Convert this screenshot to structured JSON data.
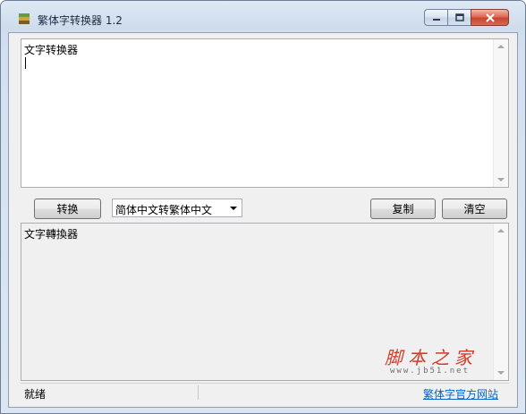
{
  "window": {
    "title": "繁体字转换器 1.2",
    "icon": "app-icon"
  },
  "caption_buttons": {
    "minimize_icon": "minimize-icon",
    "maximize_icon": "maximize-icon",
    "close_icon": "close-icon"
  },
  "input": {
    "text": "文字转换器"
  },
  "toolbar": {
    "convert_label": "转换",
    "mode_selected": "简体中文转繁体中文",
    "copy_label": "复制",
    "clear_label": "清空"
  },
  "output": {
    "text": "文字轉換器"
  },
  "statusbar": {
    "status": "就绪",
    "link": "繁体字官方网站"
  },
  "watermark": {
    "text": "脚本之家",
    "url": "www.jb51.net"
  },
  "colors": {
    "link": "#0066cc",
    "watermark": "#d23a2b",
    "close_button": "#c6452e"
  }
}
